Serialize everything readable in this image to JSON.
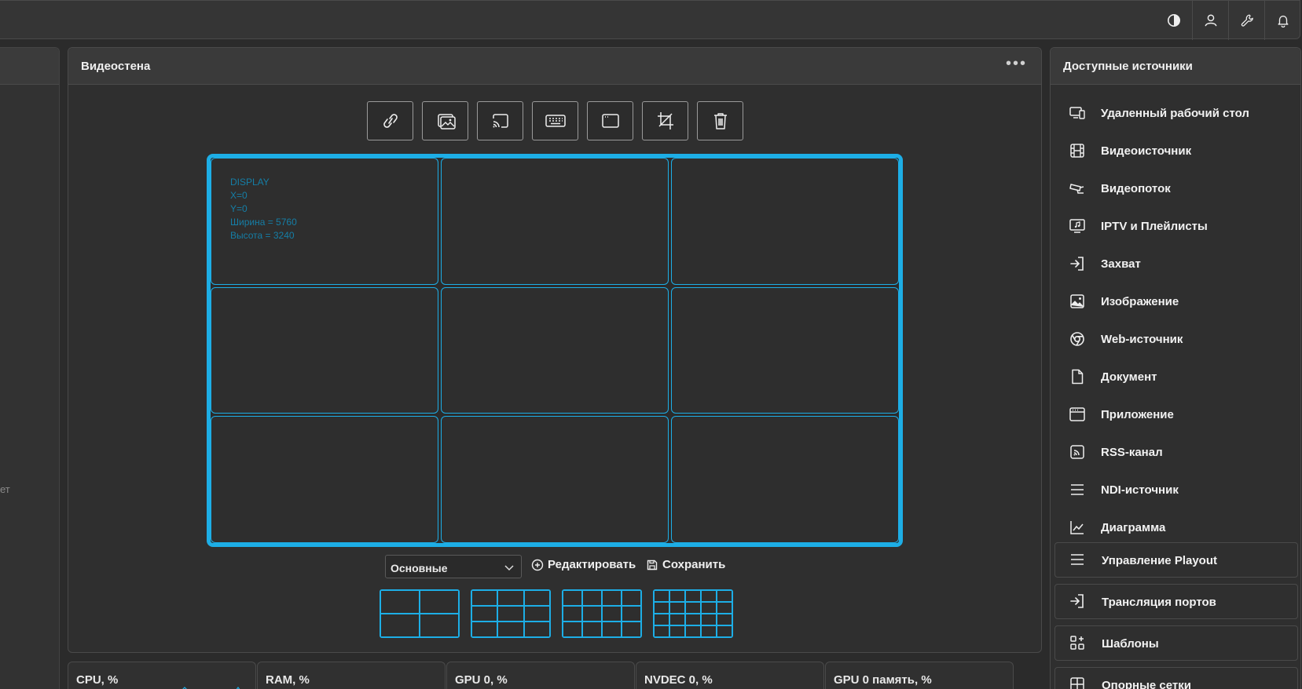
{
  "topbar": {
    "icons": [
      "contrast-icon",
      "user-icon",
      "wrench-icon",
      "bell-icon"
    ]
  },
  "left_panel": {
    "partial_text": "ет"
  },
  "videowall": {
    "title": "Видеостена",
    "more_label": "•••",
    "toolbar": [
      {
        "name": "link-icon"
      },
      {
        "name": "image-icon"
      },
      {
        "name": "cast-icon"
      },
      {
        "name": "keyboard-icon"
      },
      {
        "name": "window-icon"
      },
      {
        "name": "crop-icon"
      },
      {
        "name": "trash-icon"
      }
    ],
    "display_info": {
      "name": "DISPLAY",
      "x": "X=0",
      "y": "Y=0",
      "width": "Ширина = 5760",
      "height": "Высота = 3240"
    },
    "grid": {
      "rows": 3,
      "cols": 3
    },
    "layout_select": {
      "value": "Основные"
    },
    "edit_label": "Редактировать",
    "save_label": "Сохранить",
    "presets": [
      {
        "cols": 2,
        "rows": 2
      },
      {
        "cols": 3,
        "rows": 3
      },
      {
        "cols": 4,
        "rows": 3
      },
      {
        "cols": 5,
        "rows": 4
      }
    ],
    "accent_color": "#1daee6"
  },
  "metrics": [
    {
      "label": "CPU, %"
    },
    {
      "label": "RAM, %"
    },
    {
      "label": "GPU 0, %"
    },
    {
      "label": "NVDEC 0, %"
    },
    {
      "label": "GPU 0 память, %"
    }
  ],
  "sources": {
    "title": "Доступные источники",
    "items": [
      {
        "label": "Удаленный рабочий стол",
        "icon": "remote-desktop-icon"
      },
      {
        "label": "Видеоисточник",
        "icon": "film-icon"
      },
      {
        "label": "Видеопоток",
        "icon": "camera-icon"
      },
      {
        "label": "IPTV и Плейлисты",
        "icon": "tv-music-icon"
      },
      {
        "label": "Захват",
        "icon": "sign-in-icon"
      },
      {
        "label": "Изображение",
        "icon": "image-icon"
      },
      {
        "label": "Web-источник",
        "icon": "chrome-icon"
      },
      {
        "label": "Документ",
        "icon": "document-icon"
      },
      {
        "label": "Приложение",
        "icon": "app-window-icon"
      },
      {
        "label": "RSS-канал",
        "icon": "rss-icon"
      },
      {
        "label": "NDI-источник",
        "icon": "lines-icon"
      },
      {
        "label": "Диаграмма",
        "icon": "chart-line-icon"
      }
    ],
    "groups": [
      {
        "label": "Управление Playout",
        "icon": "lines-icon"
      },
      {
        "label": "Трансляция портов",
        "icon": "sign-in-icon"
      },
      {
        "label": "Шаблоны",
        "icon": "templates-icon"
      },
      {
        "label": "Опорные сетки",
        "icon": "grid-icon"
      }
    ]
  }
}
